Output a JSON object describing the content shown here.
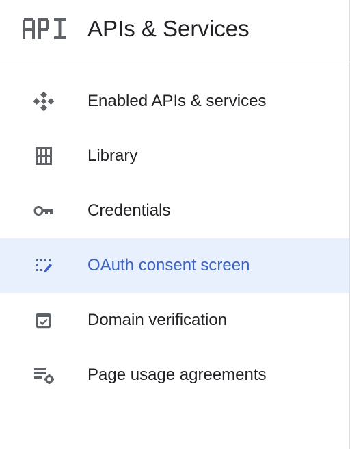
{
  "header": {
    "logo_text": "API",
    "title": "APIs & Services"
  },
  "nav": {
    "items": [
      {
        "label": "Enabled APIs & services",
        "icon": "enabled-apis-icon",
        "active": false
      },
      {
        "label": "Library",
        "icon": "library-icon",
        "active": false
      },
      {
        "label": "Credentials",
        "icon": "key-icon",
        "active": false
      },
      {
        "label": "OAuth consent screen",
        "icon": "oauth-consent-icon",
        "active": true
      },
      {
        "label": "Domain verification",
        "icon": "checkbox-icon",
        "active": false
      },
      {
        "label": "Page usage agreements",
        "icon": "list-settings-icon",
        "active": false
      }
    ]
  },
  "colors": {
    "active_background": "#e8f0fe",
    "active_text": "#3c62c4",
    "icon_gray": "#5f6368",
    "text": "#202124",
    "divider": "#dadce0"
  }
}
